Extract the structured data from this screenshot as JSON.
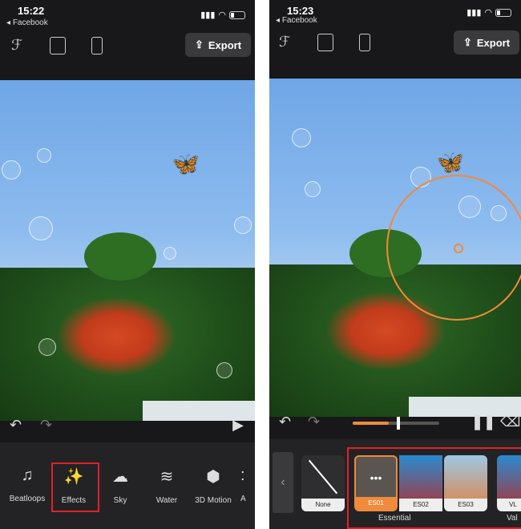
{
  "left": {
    "time": "15:22",
    "back": "Facebook",
    "export": "Export",
    "tools": [
      {
        "label": "Beatloops",
        "icon": "music-note-icon",
        "glyph": "♫"
      },
      {
        "label": "Effects",
        "icon": "magic-wand-icon",
        "glyph": "✨"
      },
      {
        "label": "Sky",
        "icon": "cloud-icon",
        "glyph": "☁"
      },
      {
        "label": "Water",
        "icon": "waves-icon",
        "glyph": "≋"
      },
      {
        "label": "3D Motion",
        "icon": "cube-icon",
        "glyph": "⬢"
      },
      {
        "label": "A"
      }
    ]
  },
  "right": {
    "time": "15:23",
    "back": "Facebook",
    "export": "Export",
    "progress": 0.42,
    "effects": [
      {
        "label": "None"
      },
      {
        "label": "ES01",
        "selected": true
      },
      {
        "label": "ES02"
      },
      {
        "label": "ES03"
      },
      {
        "label": "VL"
      }
    ],
    "groups": [
      "Essential",
      "Val"
    ]
  },
  "colors": {
    "accent": "#f08a3c",
    "highlight": "#e0202a"
  }
}
